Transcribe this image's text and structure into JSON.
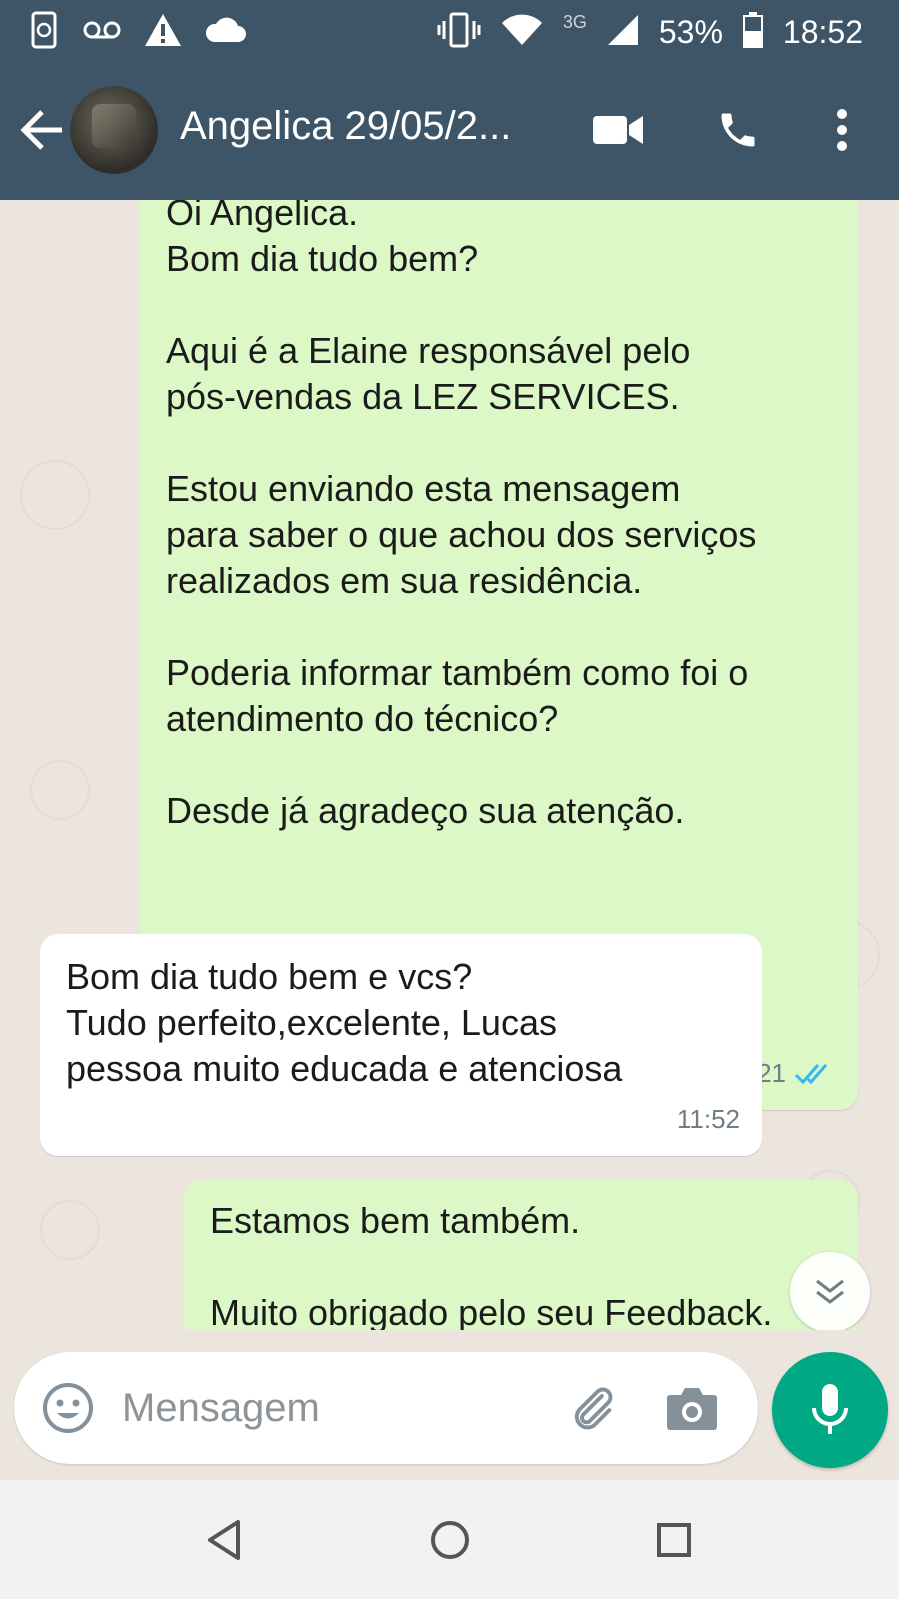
{
  "status_bar": {
    "network": "3G",
    "battery": "53%",
    "time": "18:52"
  },
  "header": {
    "contact_name": "Angelica 29/05/2...",
    "icons": [
      "back-arrow-icon",
      "video-call-icon",
      "phone-icon",
      "more-vert-icon"
    ]
  },
  "messages": [
    {
      "direction": "out",
      "text": "Oi Angelica.\nBom dia tudo bem?\n\nAqui é a Elaine responsável pelo\npós-vendas da LEZ SERVICES.\n\nEstou enviando esta mensagem\npara saber o que achou dos serviços\nrealizados em sua residência.\n\nPoderia informar também como foi o\natendimento do técnico?\n\nDesde já agradeço sua atenção.",
      "time": "09:21",
      "status": "read"
    },
    {
      "direction": "in",
      "text": "Bom dia tudo bem e vcs?\nTudo perfeito,excelente, Lucas\npessoa muito educada e atenciosa",
      "time": "11:52"
    },
    {
      "direction": "out",
      "text": "Estamos bem também.\n\nMuito obrigado pelo seu Feedback.",
      "time": ""
    }
  ],
  "composer": {
    "placeholder": "Mensagem"
  },
  "colors": {
    "header": "#3d5566",
    "outgoing_bubble": "#dcf8c6",
    "incoming_bubble": "#ffffff",
    "mic_button": "#00a884",
    "read_ticks": "#34b7f1"
  }
}
